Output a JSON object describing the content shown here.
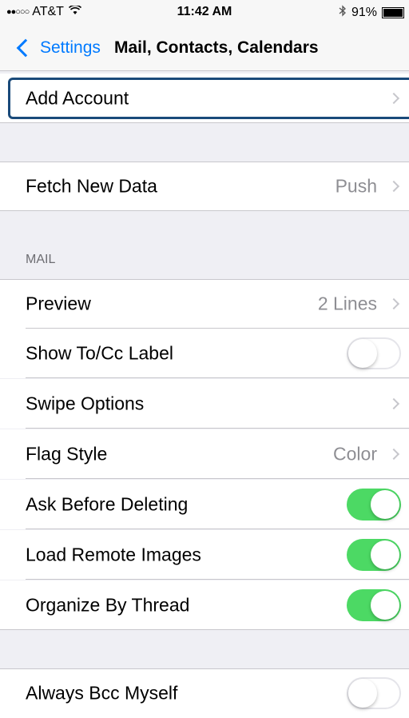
{
  "status_bar": {
    "carrier": "AT&T",
    "time": "11:42 AM",
    "battery": "91%",
    "battery_level": 0.91
  },
  "nav": {
    "back_label": "Settings",
    "title": "Mail, Contacts, Calendars"
  },
  "add_account": {
    "label": "Add Account"
  },
  "fetch": {
    "label": "Fetch New Data",
    "value": "Push"
  },
  "mail_section": {
    "header": "MAIL"
  },
  "mail_rows": {
    "preview": {
      "label": "Preview",
      "value": "2 Lines"
    },
    "show_tocc": {
      "label": "Show To/Cc Label",
      "on": false
    },
    "swipe": {
      "label": "Swipe Options"
    },
    "flag_style": {
      "label": "Flag Style",
      "value": "Color"
    },
    "ask_delete": {
      "label": "Ask Before Deleting",
      "on": true
    },
    "load_images": {
      "label": "Load Remote Images",
      "on": true
    },
    "organize_thread": {
      "label": "Organize By Thread",
      "on": true
    }
  },
  "bcc": {
    "label": "Always Bcc Myself",
    "on": false
  },
  "colors": {
    "accent": "#007aff",
    "toggle_on": "#4cd964",
    "highlight": "#1a4a7a"
  }
}
